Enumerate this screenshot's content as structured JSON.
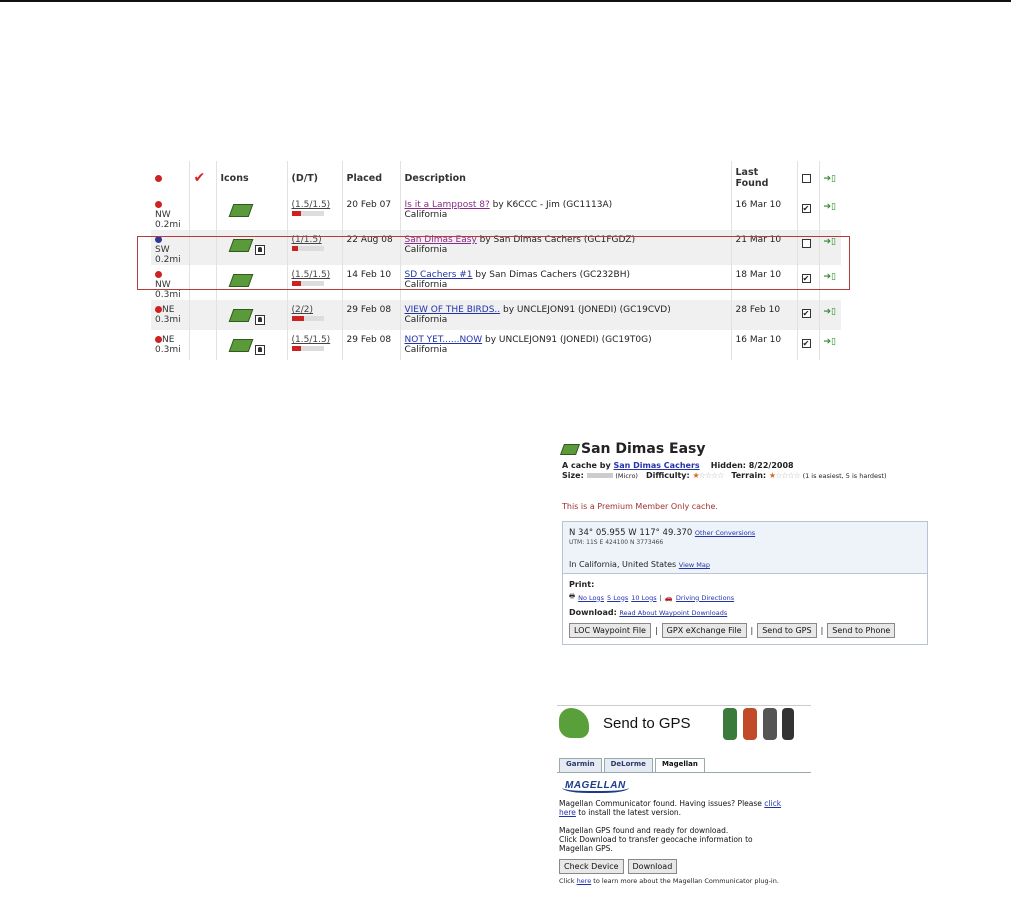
{
  "table": {
    "headers": {
      "icons": "Icons",
      "dt": "(D/T)",
      "placed": "Placed",
      "description": "Description",
      "last_found": "Last Found"
    },
    "rows": [
      {
        "dir": "NW",
        "dist": "0.2mi",
        "dt": "(1.5/1.5)",
        "placed": "20 Feb 07",
        "name": "Is it a Lamppost 8?",
        "by": " by K6CCC - Jim (GC1113A)",
        "region": "California",
        "last": "16 Mar 10",
        "checked": "✔"
      },
      {
        "dir": "SW",
        "dist": "0.2mi",
        "dt": "(1/1.5)",
        "placed": "22 Aug 08",
        "name": "San Dimas Easy",
        "by": " by San Dimas Cachers (GC1FGDZ)",
        "region": "California",
        "last": "21 Mar 10",
        "checked": ""
      },
      {
        "dir": "NW",
        "dist": "0.3mi",
        "dt": "(1.5/1.5)",
        "placed": "14 Feb 10",
        "name": "SD Cachers #1",
        "by": " by San Dimas Cachers (GC232BH)",
        "region": "California",
        "last": "18 Mar 10",
        "checked": "✔"
      },
      {
        "dir": "NE",
        "dist": "0.3mi",
        "dt": "(2/2)",
        "placed": "29 Feb 08",
        "name": "VIEW OF THE BIRDS..",
        "by": " by UNCLEJON91 (JONEDI) (GC19CVD)",
        "region": "California",
        "last": "28 Feb 10",
        "checked": "✔"
      },
      {
        "dir": "NE",
        "dist": "0.3mi",
        "dt": "(1.5/1.5)",
        "placed": "29 Feb 08",
        "name": "NOT YET......NOW",
        "by": " by UNCLEJON91 (JONEDI) (GC19T0G)",
        "region": "California",
        "last": "16 Mar 10",
        "checked": "✔"
      }
    ]
  },
  "detail": {
    "title": "San Dimas Easy",
    "by_prefix": "A cache by ",
    "owner": "San Dimas Cachers",
    "hidden": "Hidden: 8/22/2008",
    "size_label": "Size:",
    "size_value": "(Micro)",
    "difficulty_label": "Difficulty:",
    "terrain_label": "Terrain:",
    "scale_note": "(1 is easiest, 5 is hardest)",
    "premium_note": "This is a Premium Member Only cache.",
    "coords": "N 34° 05.955 W 117° 49.370",
    "other_conversions": "Other Conversions",
    "utm": "UTM: 11S E 424100 N 3773466",
    "location": "In California, United States",
    "view_map": "View Map",
    "print_label": "Print:",
    "no_logs": "No Logs",
    "five_logs": "5 Logs",
    "ten_logs": "10 Logs",
    "driving": "Driving Directions",
    "download_label": "Download:",
    "read_about": "Read About Waypoint Downloads",
    "buttons": [
      "LOC Waypoint File",
      "GPX eXchange File",
      "Send to GPS",
      "Send to Phone"
    ]
  },
  "send": {
    "title": "Send to GPS",
    "tabs": [
      "Garmin",
      "DeLorme",
      "Magellan"
    ],
    "logo": "MAGELLAN",
    "found_text": "Magellan Communicator found. Having issues? Please ",
    "click": "click",
    "here": "here",
    "install_text": " to install the latest version.",
    "ready1": "Magellan GPS found and ready for download.",
    "ready2": "Click Download to transfer geocache information to",
    "ready3": "Magellan GPS.",
    "check_device": "Check Device",
    "download": "Download",
    "foot_pre": "Click ",
    "foot_here": "here",
    "foot_post": " to learn more about the Magellan Communicator plug-in."
  }
}
